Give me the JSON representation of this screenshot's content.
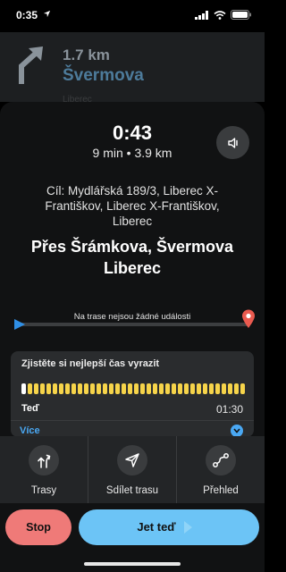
{
  "status": {
    "time": "0:35"
  },
  "turn": {
    "distance": "1.7 km",
    "street": "Švermova",
    "map_label": "Liberec"
  },
  "trip": {
    "eta": "0:43",
    "duration": "9 min",
    "separator": "•",
    "distance": "3.9 km"
  },
  "destination": {
    "text": "Cíl: Mydlářská 189/3, Liberec X-Františkov, Liberec X-Františkov, Liberec"
  },
  "route": {
    "via_line1": "Přes Šrámkova, Švermova",
    "via_line2": "Liberec",
    "events_text": "Na trase nejsou žádné události"
  },
  "departure_card": {
    "title": "Zjistěte si nejlepší čas vyrazit",
    "now_label": "Teď",
    "end_time": "01:30",
    "more_label": "Více"
  },
  "actions": [
    {
      "label": "Trasy",
      "icon": "routes-icon"
    },
    {
      "label": "Sdílet trasu",
      "icon": "share-route-icon"
    },
    {
      "label": "Přehled",
      "icon": "overview-icon"
    }
  ],
  "buttons": {
    "stop_label": "Stop",
    "go_label": "Jet teď"
  },
  "colors": {
    "accent_blue": "#6cc4f6",
    "stop_red": "#ef7a78",
    "bar_yellow": "#f6d44a",
    "link_blue": "#4aa8f3"
  }
}
